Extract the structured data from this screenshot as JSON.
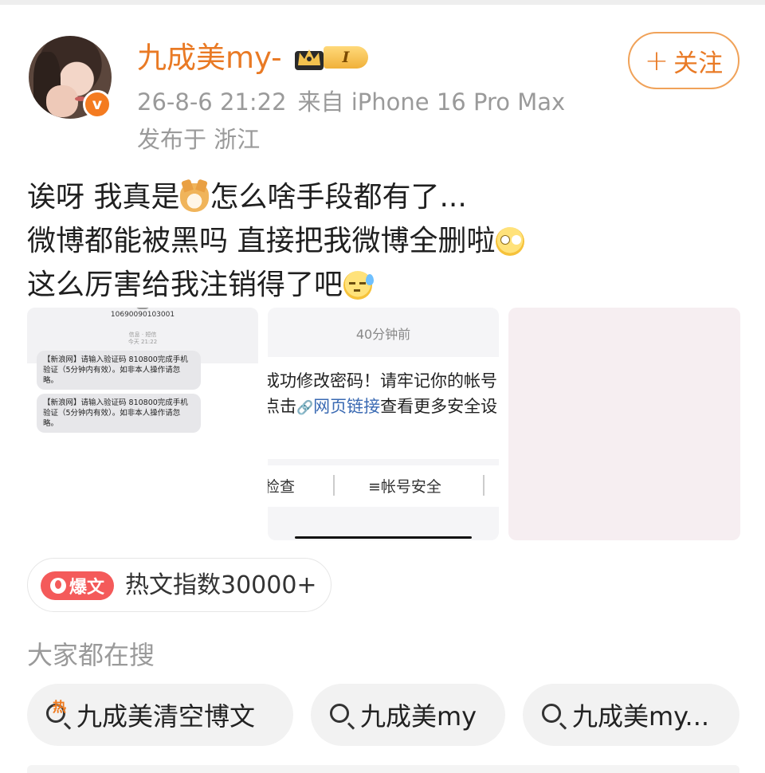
{
  "author": {
    "name": "九成美my-",
    "verified_mark": "v",
    "rank_badge": "I",
    "timestamp": "26-8-6 21:22",
    "source": "来自 iPhone 16 Pro Max",
    "location": "发布于 浙江"
  },
  "follow_button": {
    "plus": "+",
    "label": "关注"
  },
  "post": {
    "line1_a": "诶呀 我真是",
    "line1_b": "怎么啥手段都有了...",
    "line2": "微博都能被黑吗 直接把我微博全删啦",
    "line3": "这么厉害给我注销得了吧",
    "emoji": [
      "dog-emoji",
      "eye-roll-emoji",
      "sweat-emoji"
    ]
  },
  "images": {
    "sms": {
      "number": "10690090103001",
      "meta_line1": "信息 · 短信",
      "meta_line2": "今天 21:22",
      "msg1": "【新浪网】请输入验证码 810800完成手机验证（5分钟内有效）。如非本人操作请忽略。",
      "msg2": "【新浪网】请输入验证码 810800完成手机验证（5分钟内有效）。如非本人操作请忽略。"
    },
    "notice": {
      "time": "40分钟前",
      "line1": "成功修改密码！请牢记你的帐号",
      "line2_prefix": "点击",
      "link_icon": "🔗",
      "link_text": "网页链接",
      "line2_suffix": "查看更多安全设",
      "action1": "检查",
      "action2_icon": "≡",
      "action2": "帐号安全"
    }
  },
  "hot": {
    "tag": "爆文",
    "text": "热文指数30000+"
  },
  "search": {
    "title": "大家都在搜",
    "hot_icon": "热",
    "items": [
      "九成美清空博文",
      "九成美my",
      "九成美my..."
    ]
  },
  "colors": {
    "accent": "#e97a25",
    "hot_red": "#f45a5a",
    "muted": "#9a9a9a"
  }
}
